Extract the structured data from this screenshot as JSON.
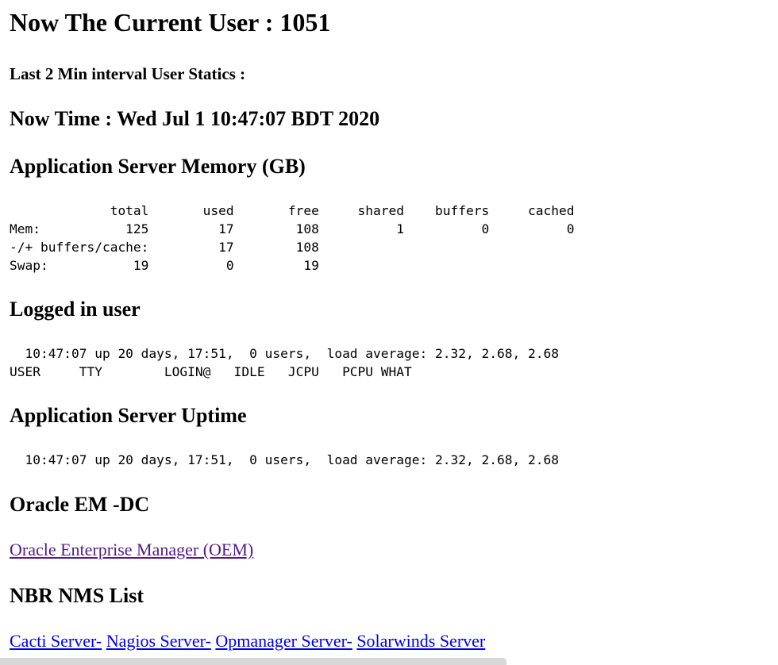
{
  "header": {
    "current_user": "Now The Current User : 1051",
    "interval_label": "Last 2 Min interval User Statics :",
    "now_time": "Now Time : Wed Jul 1 10:47:07 BDT 2020"
  },
  "memory": {
    "title": "Application Server Memory (GB)",
    "output": "             total       used       free     shared    buffers     cached\nMem:           125         17        108          1          0          0\n-/+ buffers/cache:         17        108\nSwap:           19          0         19"
  },
  "logged_in": {
    "title": "Logged in user",
    "output": "  10:47:07 up 20 days, 17:51,  0 users,  load average: 2.32, 2.68, 2.68\nUSER     TTY        LOGIN@   IDLE   JCPU   PCPU WHAT"
  },
  "uptime": {
    "title": "Application Server Uptime",
    "output": "  10:47:07 up 20 days, 17:51,  0 users,  load average: 2.32, 2.68, 2.68"
  },
  "oracle": {
    "title": "Oracle EM -DC",
    "link": "Oracle Enterprise Manager (OEM)"
  },
  "nms": {
    "title": "NBR NMS List",
    "links": [
      "Cacti Server-",
      "Nagios Server-",
      "Opmanager Server-",
      "Solarwinds Server"
    ]
  }
}
